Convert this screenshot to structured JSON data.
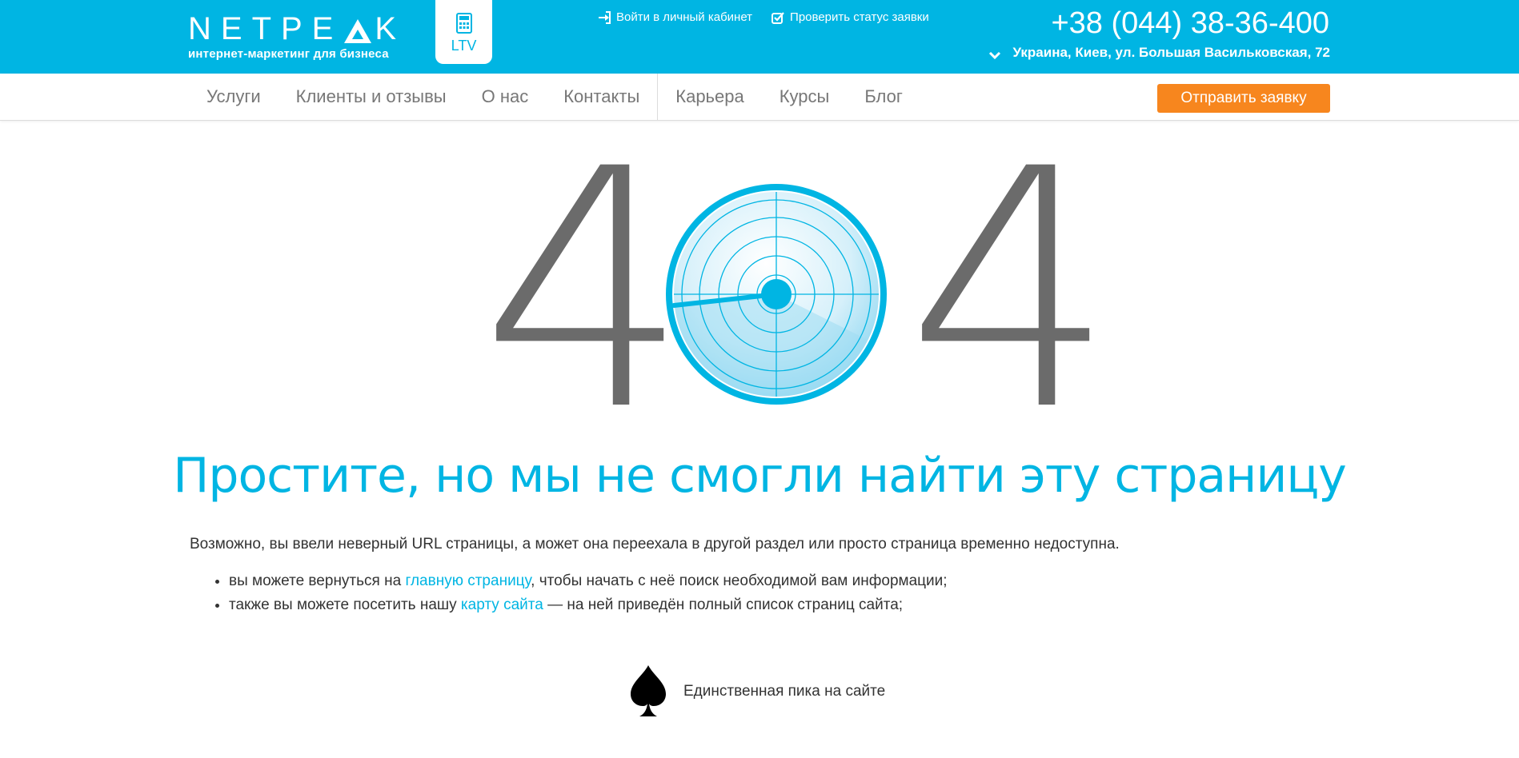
{
  "header": {
    "logo_text": "NETPEAK",
    "logo_tagline": "интернет-маркетинг для бизнеса",
    "ltv_label": "LTV",
    "login_link": "Войти в личный кабинет",
    "status_link": "Проверить статус заявки",
    "phone": "+38 (044) 38-36-400",
    "address": "Украина, Киев, ул. Большая Васильковская, 72",
    "accent_color": "#00b5e3"
  },
  "nav": {
    "items": [
      "Услуги",
      "Клиенты и отзывы",
      "О нас",
      "Контакты",
      "Карьера",
      "Курсы",
      "Блог"
    ],
    "cta_label": "Отправить заявку",
    "cta_color": "#f7861e"
  },
  "error": {
    "digit_left": "4",
    "digit_right": "4",
    "heading": "Простите, но мы не смогли найти эту страницу",
    "intro": "Возможно, вы ввели неверный URL страницы, а может она переехала в другой раздел или просто страница временно недоступна.",
    "tip1_before": "вы можете вернуться на ",
    "tip1_link": "главную страницу",
    "tip1_after": ", чтобы начать с неё поиск необходимой вам информации;",
    "tip2_before": "также вы можете посетить нашу ",
    "tip2_link": "карту сайта",
    "tip2_after": " — на ней приведён полный список страниц сайта;"
  },
  "footer_note": {
    "text": "Единственная пика на сайте",
    "icon": "spade-icon"
  }
}
